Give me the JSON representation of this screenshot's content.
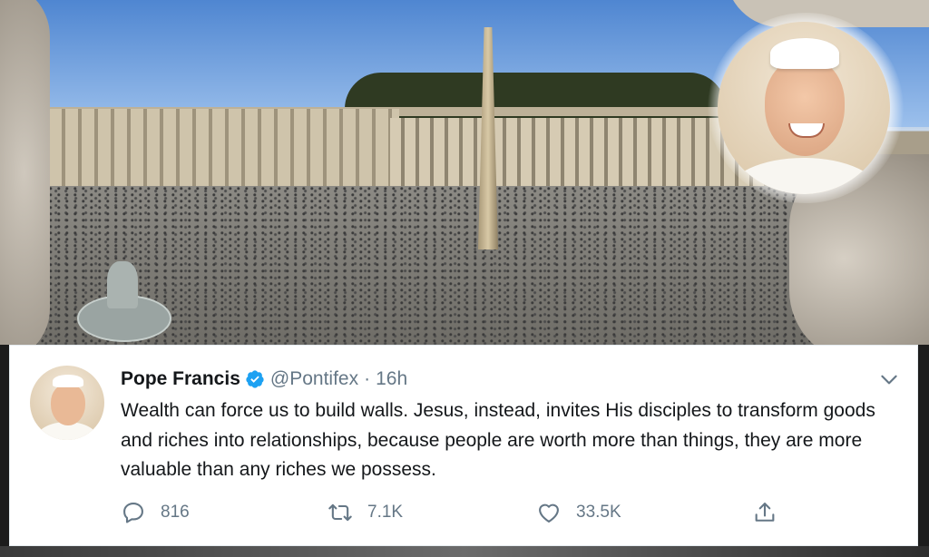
{
  "tweet": {
    "name": "Pope Francis",
    "handle": "@Pontifex",
    "separator": "·",
    "time": "16h",
    "text": "Wealth can force us to build walls. Jesus, instead, invites His disciples to transform goods and riches into relationships, because people are worth more than things, they are more valuable than any riches we possess.",
    "actions": {
      "reply": {
        "icon": "reply-icon",
        "count": "816"
      },
      "retweet": {
        "icon": "retweet-icon",
        "count": "7.1K"
      },
      "like": {
        "icon": "heart-icon",
        "count": "33.5K"
      },
      "share": {
        "icon": "share-icon"
      }
    }
  },
  "colors": {
    "verified": "#1da1f2",
    "text": "#14171a",
    "muted": "#657786"
  }
}
